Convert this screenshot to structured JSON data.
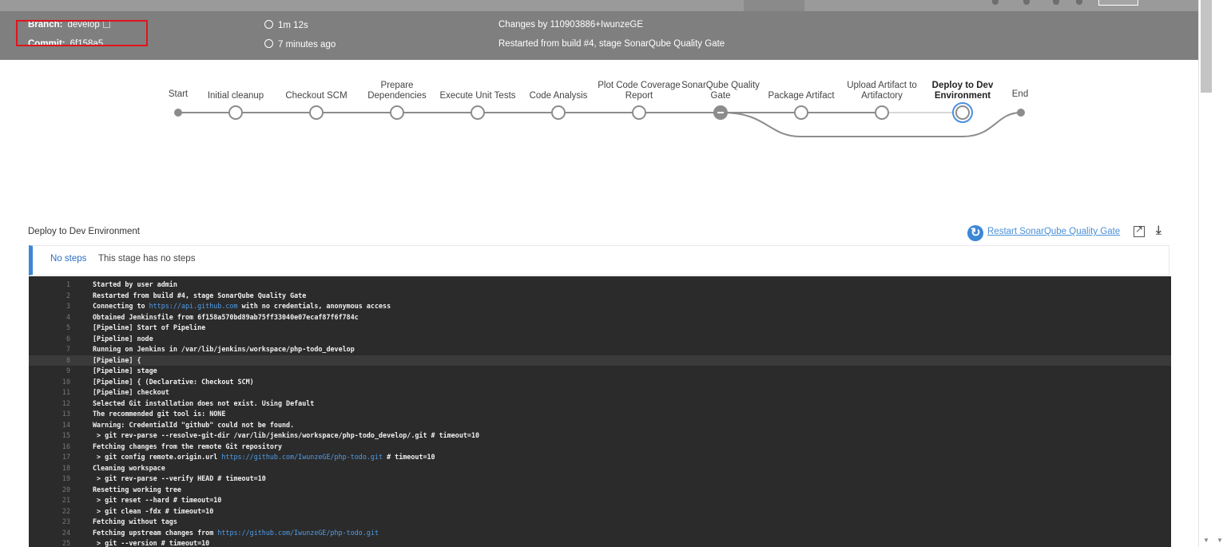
{
  "header": {
    "branch_label": "Branch:",
    "branch_value": "develop",
    "commit_label": "Commit:",
    "commit_value": "6f158a5",
    "duration": "1m 12s",
    "time_ago": "7 minutes ago",
    "changes": "Changes by 110903886+IwunzeGE",
    "restarted_from": "Restarted from build #4, stage SonarQube Quality Gate"
  },
  "pipeline": {
    "start_label": "Start",
    "end_label": "End",
    "stages": [
      {
        "label": "Initial cleanup",
        "status": "not-built"
      },
      {
        "label": "Checkout SCM",
        "status": "not-built"
      },
      {
        "label": "Prepare Dependencies",
        "status": "not-built"
      },
      {
        "label": "Execute Unit Tests",
        "status": "not-built"
      },
      {
        "label": "Code Analysis",
        "status": "not-built"
      },
      {
        "label": "Plot Code Coverage Report",
        "status": "not-built"
      },
      {
        "label": "SonarQube Quality Gate",
        "status": "skipped"
      },
      {
        "label": "Package Artifact",
        "status": "not-built"
      },
      {
        "label": "Upload Artifact to Artifactory",
        "status": "not-built"
      },
      {
        "label": "Deploy to Dev Environment",
        "status": "selected"
      }
    ]
  },
  "detail": {
    "stage_title": "Deploy to Dev Environment",
    "restart_link": "Restart SonarQube Quality Gate",
    "no_steps_label": "No steps",
    "no_steps_message": "This stage has no steps"
  },
  "colors": {
    "header_bg": "#7f7f7f",
    "accent": "#3c87d6",
    "log_bg": "#2b2b2b",
    "highlight_box": "#e0141c"
  },
  "log": [
    {
      "n": "1",
      "parts": [
        {
          "t": "Started by user admin"
        }
      ]
    },
    {
      "n": "2",
      "parts": [
        {
          "t": "Restarted from build #4, stage SonarQube Quality Gate"
        }
      ]
    },
    {
      "n": "3",
      "parts": [
        {
          "t": "Connecting to "
        },
        {
          "t": "https://api.github.com",
          "url": true
        },
        {
          "t": " with no credentials, anonymous access"
        }
      ]
    },
    {
      "n": "4",
      "parts": [
        {
          "t": "Obtained Jenkinsfile from 6f158a570bd89ab75ff33040e07ecaf87f6f784c"
        }
      ]
    },
    {
      "n": "5",
      "parts": [
        {
          "t": "[Pipeline] Start of Pipeline"
        }
      ]
    },
    {
      "n": "6",
      "parts": [
        {
          "t": "[Pipeline] node"
        }
      ]
    },
    {
      "n": "7",
      "parts": [
        {
          "t": "Running on Jenkins in /var/lib/jenkins/workspace/php-todo_develop"
        }
      ]
    },
    {
      "n": "8",
      "parts": [
        {
          "t": "[Pipeline] {"
        }
      ],
      "highlight": true
    },
    {
      "n": "9",
      "parts": [
        {
          "t": "[Pipeline] stage"
        }
      ]
    },
    {
      "n": "10",
      "parts": [
        {
          "t": "[Pipeline] { (Declarative: Checkout SCM)"
        }
      ]
    },
    {
      "n": "11",
      "parts": [
        {
          "t": "[Pipeline] checkout"
        }
      ]
    },
    {
      "n": "12",
      "parts": [
        {
          "t": "Selected Git installation does not exist. Using Default"
        }
      ]
    },
    {
      "n": "13",
      "parts": [
        {
          "t": "The recommended git tool is: NONE"
        }
      ]
    },
    {
      "n": "14",
      "parts": [
        {
          "t": "Warning: CredentialId \"github\" could not be found."
        }
      ]
    },
    {
      "n": "15",
      "parts": [
        {
          "t": " > git rev-parse --resolve-git-dir /var/lib/jenkins/workspace/php-todo_develop/.git # timeout=10"
        }
      ]
    },
    {
      "n": "16",
      "parts": [
        {
          "t": "Fetching changes from the remote Git repository"
        }
      ]
    },
    {
      "n": "17",
      "parts": [
        {
          "t": " > git config remote.origin.url "
        },
        {
          "t": "https://github.com/IwunzeGE/php-todo.git",
          "url": true
        },
        {
          "t": " # timeout=10"
        }
      ]
    },
    {
      "n": "18",
      "parts": [
        {
          "t": "Cleaning workspace"
        }
      ]
    },
    {
      "n": "19",
      "parts": [
        {
          "t": " > git rev-parse --verify HEAD # timeout=10"
        }
      ]
    },
    {
      "n": "20",
      "parts": [
        {
          "t": "Resetting working tree"
        }
      ]
    },
    {
      "n": "21",
      "parts": [
        {
          "t": " > git reset --hard # timeout=10"
        }
      ]
    },
    {
      "n": "22",
      "parts": [
        {
          "t": " > git clean -fdx # timeout=10"
        }
      ]
    },
    {
      "n": "23",
      "parts": [
        {
          "t": "Fetching without tags"
        }
      ]
    },
    {
      "n": "24",
      "parts": [
        {
          "t": "Fetching upstream changes from "
        },
        {
          "t": "https://github.com/IwunzeGE/php-todo.git",
          "url": true
        }
      ]
    },
    {
      "n": "25",
      "parts": [
        {
          "t": " > git --version # timeout=10"
        }
      ]
    }
  ]
}
